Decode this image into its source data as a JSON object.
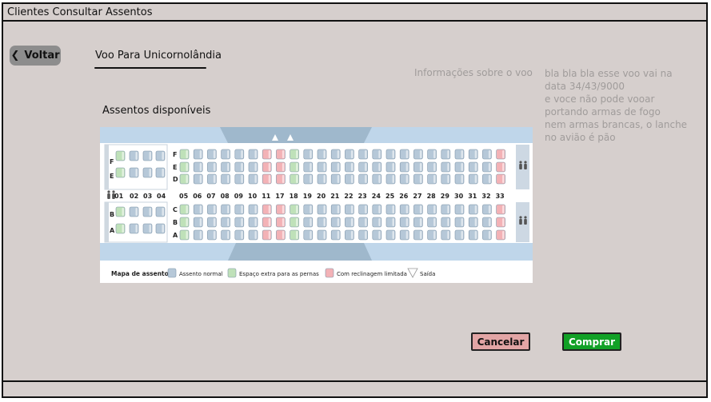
{
  "window": {
    "title": "Clientes Consultar Assentos"
  },
  "nav": {
    "back_label": "Voltar"
  },
  "flight": {
    "title": "Voo Para Unicornolândia"
  },
  "info": {
    "label": "Informações sobre o voo",
    "lines": [
      "bla bla bla esse voo vai na",
      "data 34/43/9000",
      "e voce não pode vooar",
      "portando armas de fogo",
      "nem armas brancas, o lanche",
      "no avião é pão"
    ]
  },
  "seats": {
    "title": "Assentos disponíveis",
    "row_numbers": [
      "01",
      "02",
      "03",
      "04",
      "05",
      "06",
      "07",
      "08",
      "09",
      "10",
      "11",
      "17",
      "18",
      "19",
      "20",
      "21",
      "22",
      "23",
      "24",
      "25",
      "26",
      "27",
      "28",
      "29",
      "30",
      "31",
      "32",
      "33"
    ],
    "top_letters_front": [
      "F",
      "E"
    ],
    "top_letters_main": [
      "F",
      "E",
      "D"
    ],
    "bottom_letters_main": [
      "C",
      "B",
      "A"
    ],
    "bottom_letters_front": [
      "B",
      "A"
    ],
    "legend": {
      "title": "Mapa de assentos:",
      "normal": "Assento normal",
      "extra": "Espaço extra para as pernas",
      "limited": "Com reclinagem limitada",
      "exit": "Saída"
    },
    "colors": {
      "normal": "#b6c8d8",
      "extra": "#bfe1b9",
      "limited": "#f3b2b6",
      "aisle": "#dbe7f2"
    }
  },
  "actions": {
    "cancel_label": "Cancelar",
    "confirm_label": "Comprar"
  }
}
